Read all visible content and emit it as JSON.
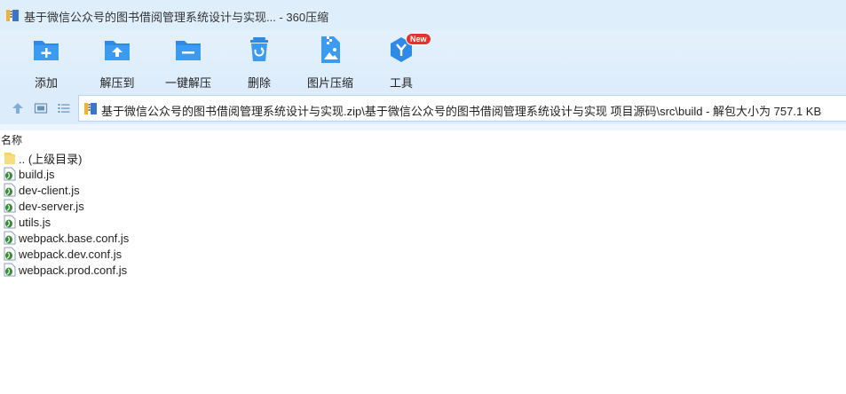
{
  "window": {
    "title": "基于微信公众号的图书借阅管理系统设计与实现... - 360压缩"
  },
  "toolbar": {
    "items": [
      {
        "label": "添加",
        "icon": "add-icon"
      },
      {
        "label": "解压到",
        "icon": "extract-to-icon"
      },
      {
        "label": "一键解压",
        "icon": "one-click-extract-icon"
      },
      {
        "label": "删除",
        "icon": "delete-icon"
      },
      {
        "label": "图片压缩",
        "icon": "image-compress-icon"
      },
      {
        "label": "工具",
        "icon": "tools-icon",
        "badge": "New"
      }
    ]
  },
  "address": {
    "path": "基于微信公众号的图书借阅管理系统设计与实现.zip\\基于微信公众号的图书借阅管理系统设计与实现 项目源码\\src\\build - 解包大小为 757.1 KB"
  },
  "list": {
    "header": "名称",
    "rows": [
      {
        "name": ".. (上级目录)",
        "type": "folder"
      },
      {
        "name": "build.js",
        "type": "js"
      },
      {
        "name": "dev-client.js",
        "type": "js"
      },
      {
        "name": "dev-server.js",
        "type": "js"
      },
      {
        "name": "utils.js",
        "type": "js"
      },
      {
        "name": "webpack.base.conf.js",
        "type": "js"
      },
      {
        "name": "webpack.dev.conf.js",
        "type": "js"
      },
      {
        "name": "webpack.prod.conf.js",
        "type": "js"
      }
    ]
  },
  "colors": {
    "toolbar_bg": "#dcecfb",
    "icon_blue": "#2d8ae6",
    "badge_red": "#e8312f"
  }
}
